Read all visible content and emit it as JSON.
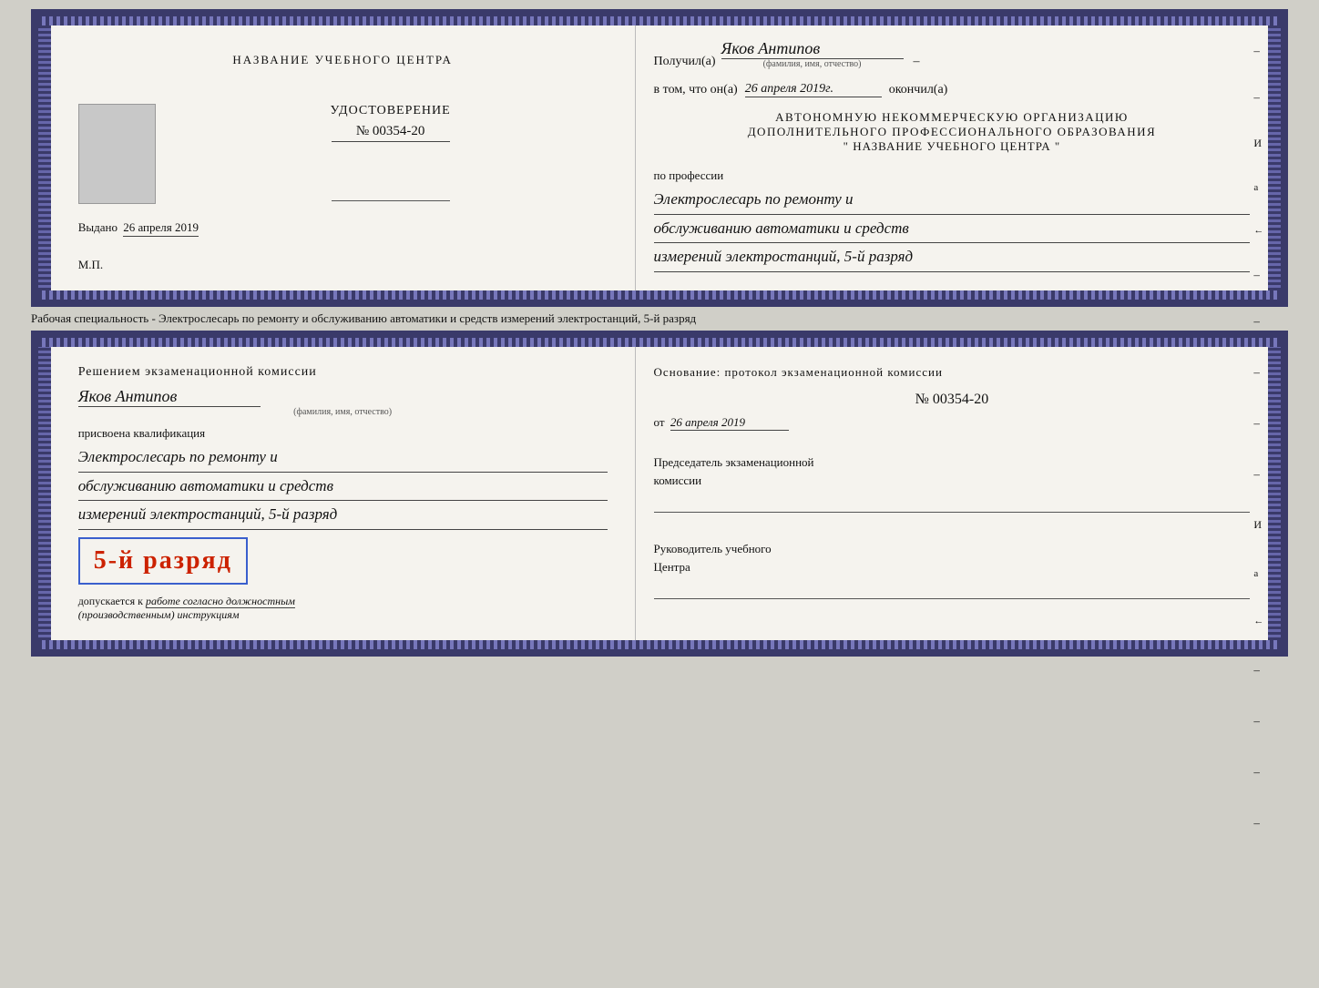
{
  "top_doc": {
    "left": {
      "center_title": "НАЗВАНИЕ УЧЕБНОГО ЦЕНТРА",
      "udostoverenie": "УДОСТОВЕРЕНИЕ",
      "number": "№ 00354-20",
      "vydano_label": "Выдано",
      "vydano_value": "26 апреля 2019",
      "mp": "М.П."
    },
    "right": {
      "poluchil_label": "Получил(а)",
      "recipient_name": "Яков Антипов",
      "fio_subtitle": "(фамилия, имя, отчество)",
      "dash": "–",
      "vtom_label": "в том, что он(а)",
      "completion_date": "26 апреля 2019г.",
      "okonchil": "окончил(а)",
      "org_line1": "АВТОНОМНУЮ НЕКОММЕРЧЕСКУЮ ОРГАНИЗАЦИЮ",
      "org_line2": "ДОПОЛНИТЕЛЬНОГО ПРОФЕССИОНАЛЬНОГО ОБРАЗОВАНИЯ",
      "org_quote": "\"    НАЗВАНИЕ УЧЕБНОГО ЦЕНТРА    \"",
      "po_professii": "по профессии",
      "profession_line1": "Электрослесарь по ремонту и",
      "profession_line2": "обслуживанию автоматики и средств",
      "profession_line3": "измерений электростанций, 5-й разряд"
    }
  },
  "separator": {
    "text": "Рабочая специальность - Электрослесарь по ремонту и обслуживанию автоматики и средств измерений электростанций, 5-й разряд"
  },
  "bottom_doc": {
    "left": {
      "komissia_title": "Решением экзаменационной комиссии",
      "recipient_name": "Яков Антипов",
      "fio_subtitle": "(фамилия, имя, отчество)",
      "prisvoena": "присвоена квалификация",
      "qual_line1": "Электрослесарь по ремонту и",
      "qual_line2": "обслуживанию автоматики и средств",
      "qual_line3": "измерений электростанций, 5-й разряд",
      "badge_text": "5-й разряд",
      "dopuskaetsya": "допускается к",
      "dopusk_text": "работе согласно должностным",
      "dopusk_text2": "(производственным) инструкциям"
    },
    "right": {
      "osnov_label": "Основание: протокол экзаменационной комиссии",
      "no_label": "№ 00354-20",
      "ot_label": "от",
      "ot_date": "26 апреля 2019",
      "predsedatel_label": "Председатель экзаменационной",
      "komissia_label": "комиссии",
      "rukov_label": "Руководитель учебного",
      "centr_label": "Центра"
    }
  }
}
